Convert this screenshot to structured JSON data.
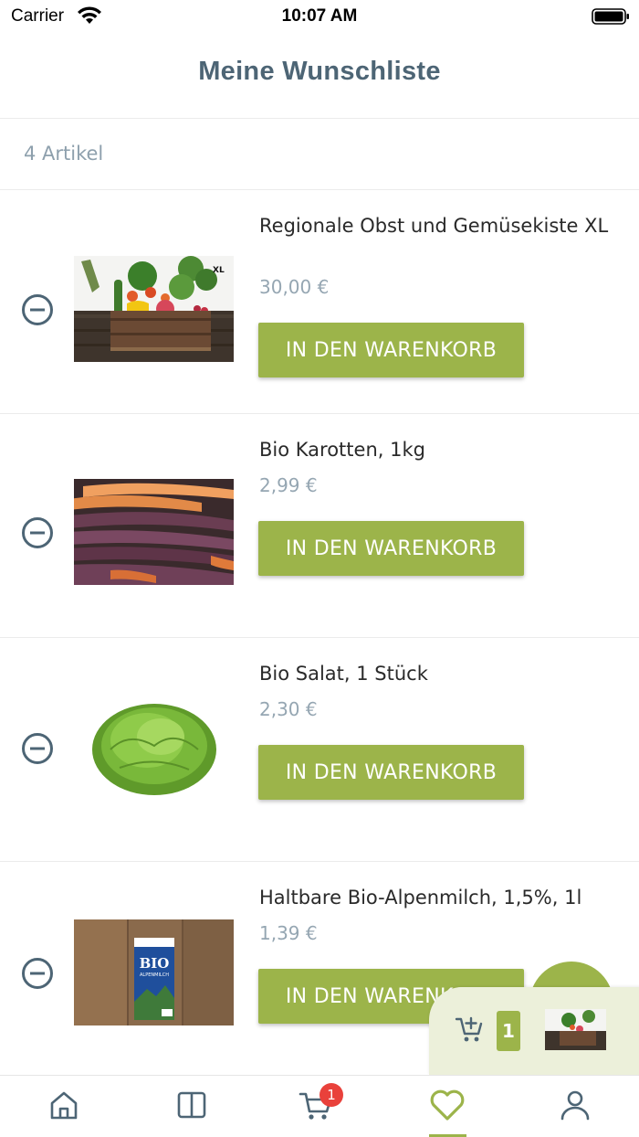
{
  "status_bar": {
    "carrier": "Carrier",
    "time": "10:07 AM"
  },
  "header": {
    "title": "Meine Wunschliste"
  },
  "summary": {
    "count_text": "4 Artikel"
  },
  "items": [
    {
      "name": "Regionale Obst und Gemüsekiste XL",
      "price": "30,00 €",
      "button_label": "IN DEN WARENKORB",
      "badge": "XL"
    },
    {
      "name": "Bio Karotten, 1kg",
      "price": "2,99 €",
      "button_label": "IN DEN WARENKORB"
    },
    {
      "name": "Bio Salat, 1 Stück",
      "price": "2,30 €",
      "button_label": "IN DEN WARENKORB"
    },
    {
      "name": "Haltbare Bio-Alpenmilch, 1,5%, 1l",
      "price": "1,39 €",
      "button_label": "IN DEN WARENKORB",
      "pack_text": "BIO",
      "pack_sub": "ALPENMILCH"
    }
  ],
  "mini_cart": {
    "count": "1"
  },
  "tabbar": {
    "cart_badge": "1",
    "active_tab": "wishlist"
  },
  "colors": {
    "accent": "#9cb44a",
    "title": "#4d6575",
    "muted": "#95a6b2",
    "badge": "#e9413b",
    "minicart_bg": "#ecf0da"
  }
}
